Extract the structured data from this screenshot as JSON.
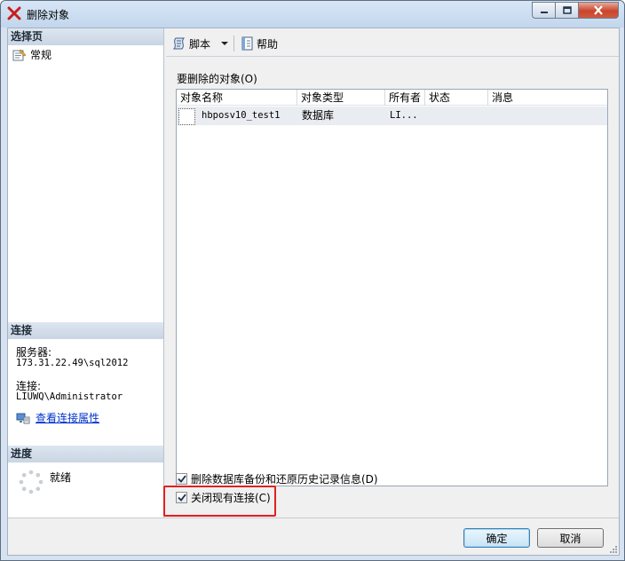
{
  "window": {
    "title": "删除对象"
  },
  "left": {
    "select_page_header": "选择页",
    "nav_items": [
      {
        "label": "常规",
        "icon": "page-icon"
      }
    ],
    "connection_header": "连接",
    "server_label": "服务器:",
    "server_value": "173.31.22.49\\sql2012",
    "connection_label": "连接:",
    "connection_value": "LIUWQ\\Administrator",
    "view_properties_link": "查看连接属性",
    "progress_header": "进度",
    "progress_status": "就绪"
  },
  "toolbar": {
    "script_label": "脚本",
    "help_label": "帮助"
  },
  "objects": {
    "label": "要删除的对象(O)",
    "columns": [
      "对象名称",
      "对象类型",
      "所有者",
      "状态",
      "消息"
    ],
    "rows": [
      {
        "name": "hbposv10_test1",
        "type": "数据库",
        "owner": "LI...",
        "status": "",
        "message": ""
      }
    ]
  },
  "options": {
    "delete_backup_history": {
      "label": "删除数据库备份和还原历史记录信息(D)",
      "checked": true
    },
    "close_connections": {
      "label": "关闭现有连接(C)",
      "checked": true
    }
  },
  "buttons": {
    "ok": "确定",
    "cancel": "取消"
  },
  "colors": {
    "highlight_box": "#e02020",
    "link": "#0033cc",
    "section_header": "#c9d5e3"
  }
}
